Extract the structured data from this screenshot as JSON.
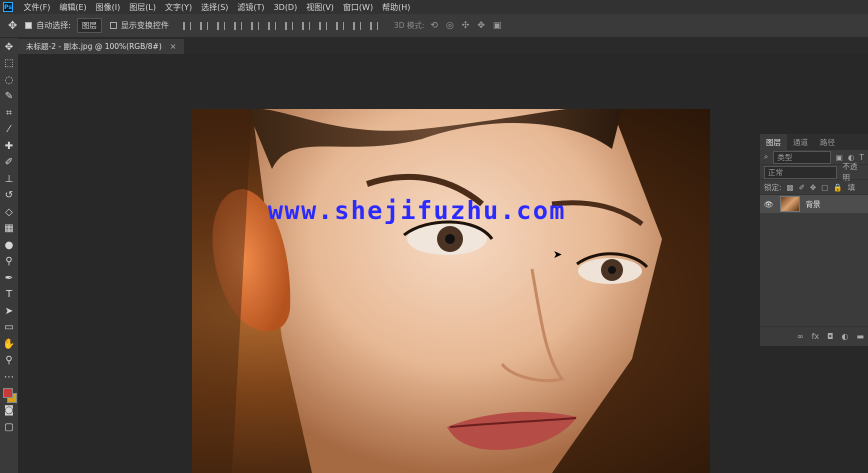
{
  "menubar": {
    "logo": "Ps",
    "items": [
      "文件(F)",
      "编辑(E)",
      "图像(I)",
      "图层(L)",
      "文字(Y)",
      "选择(S)",
      "滤镜(T)",
      "3D(D)",
      "视图(V)",
      "窗口(W)",
      "帮助(H)"
    ]
  },
  "options": {
    "auto_select_label": "自动选择:",
    "auto_select_value": "图层",
    "show_transform_label": "显示变换控件",
    "mode_3d_label": "3D 模式:"
  },
  "document": {
    "tab_title": "未标题-2 - 副本.jpg @ 100%(RGB/8#)",
    "close": "×"
  },
  "watermark": "www.shejifuzhu.com",
  "layers_panel": {
    "tabs": [
      "图层",
      "通道",
      "路径"
    ],
    "filter_placeholder": "类型",
    "blend_mode": "正常",
    "opacity_label": "不透明",
    "lock_label": "锁定:",
    "fill_label": "填",
    "layer_name": "背景"
  },
  "colors": {
    "foreground": "#c83a3a",
    "background": "#d4a017",
    "watermark": "#2b2bff"
  }
}
